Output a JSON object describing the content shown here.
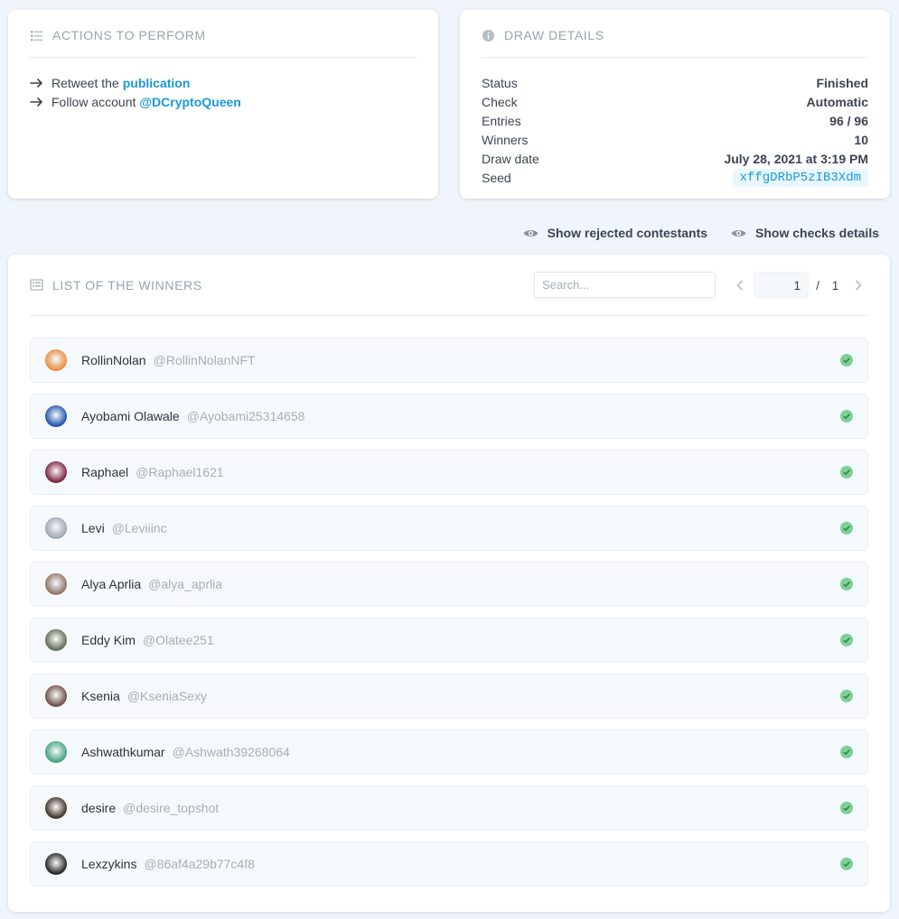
{
  "actions": {
    "title": "ACTIONS TO PERFORM",
    "items": [
      {
        "text": "Retweet the",
        "link": "publication"
      },
      {
        "text": "Follow account",
        "link": "@DCryptoQueen"
      }
    ]
  },
  "details": {
    "title": "DRAW DETAILS",
    "rows": [
      {
        "label": "Status",
        "value": "Finished"
      },
      {
        "label": "Check",
        "value": "Automatic"
      },
      {
        "label": "Entries",
        "value": "96 / 96"
      },
      {
        "label": "Winners",
        "value": "10"
      },
      {
        "label": "Draw date",
        "value": "July 28, 2021 at 3:19 PM"
      },
      {
        "label": "Seed",
        "value": "xffgDRbP5zIB3Xdm"
      }
    ]
  },
  "toggles": {
    "rejected": "Show rejected contestants",
    "checks": "Show checks details"
  },
  "winners": {
    "title": "LIST OF THE WINNERS",
    "search_placeholder": "Search...",
    "page_current": "1",
    "page_sep": "/",
    "page_total": "1",
    "list": [
      {
        "name": "RollinNolan",
        "handle": "@RollinNolanNFT",
        "avatar": "#e88a3c"
      },
      {
        "name": "Ayobami Olawale",
        "handle": "@Ayobami25314658",
        "avatar": "#1c4fa8"
      },
      {
        "name": "Raphael",
        "handle": "@Raphael1621",
        "avatar": "#7a1d3a"
      },
      {
        "name": "Levi",
        "handle": "@Leviiinc",
        "avatar": "#9aa3ad"
      },
      {
        "name": "Alya Aprlia",
        "handle": "@alya_aprlia",
        "avatar": "#8a7060"
      },
      {
        "name": "Eddy Kim",
        "handle": "@Olatee251",
        "avatar": "#5d6b4f"
      },
      {
        "name": "Ksenia",
        "handle": "@KseniaSexy",
        "avatar": "#6b4a3f"
      },
      {
        "name": "Ashwathkumar",
        "handle": "@Ashwath39268064",
        "avatar": "#3fa07a"
      },
      {
        "name": "desire",
        "handle": "@desire_topshot",
        "avatar": "#3e2c22"
      },
      {
        "name": "Lexzykins",
        "handle": "@86af4a29b77c4f8",
        "avatar": "#1e1e1e"
      }
    ]
  },
  "colors": {
    "accent": "#1a98da",
    "success": "#6cc08a"
  }
}
